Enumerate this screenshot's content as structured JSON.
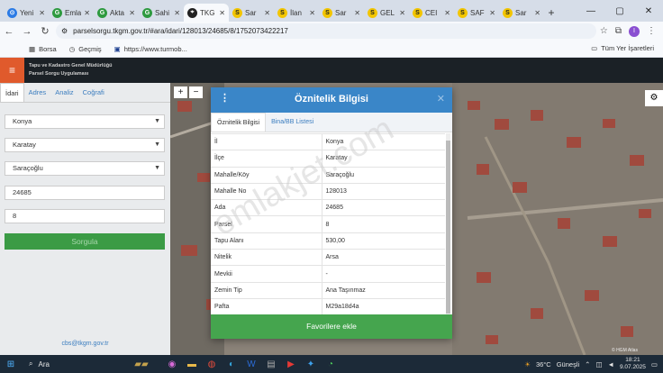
{
  "browser": {
    "tabs": [
      {
        "title": "Yeni",
        "icon": "chrome-icon",
        "color": "#2c7be5",
        "glyph": "⊙"
      },
      {
        "title": "Emla",
        "icon": "emlakjet-icon",
        "color": "#2e9a3f",
        "glyph": "G"
      },
      {
        "title": "Akta",
        "icon": "emlakjet-icon",
        "color": "#2e9a3f",
        "glyph": "G"
      },
      {
        "title": "Sahi",
        "icon": "emlakjet-icon",
        "color": "#2e9a3f",
        "glyph": "G"
      },
      {
        "title": "TKG",
        "icon": "location-pin-icon",
        "color": "#222222",
        "glyph": "⌖",
        "active": true
      },
      {
        "title": "Sar",
        "icon": "sahibinden-icon",
        "color": "#f2c500",
        "glyph": "S"
      },
      {
        "title": "İlan",
        "icon": "sahibinden-icon",
        "color": "#f2c500",
        "glyph": "S"
      },
      {
        "title": "Sar",
        "icon": "sahibinden-icon",
        "color": "#f2c500",
        "glyph": "S"
      },
      {
        "title": "GEL",
        "icon": "sahibinden-icon",
        "color": "#f2c500",
        "glyph": "S"
      },
      {
        "title": "CEI",
        "icon": "sahibinden-icon",
        "color": "#f2c500",
        "glyph": "S"
      },
      {
        "title": "SAF",
        "icon": "sahibinden-icon",
        "color": "#f2c500",
        "glyph": "S"
      },
      {
        "title": "Sar",
        "icon": "sahibinden-icon",
        "color": "#f2c500",
        "glyph": "S"
      }
    ],
    "url": "parselsorgu.tkgm.gov.tr/#ara/idari/128013/24685/8/1752073422217",
    "bookmarks": [
      {
        "label": "Borsa",
        "icon": "bookmark-icon"
      },
      {
        "label": "Geçmiş",
        "icon": "history-icon"
      },
      {
        "label": "https://www.turmob...",
        "icon": "turmob-icon"
      }
    ],
    "all_bookmarks": "Tüm Yer İşaretleri",
    "avatar_letter": "I"
  },
  "app": {
    "title_line1": "Tapu ve Kadastro Genel Müdürlüğü",
    "title_line2": "Parsel Sorgu Uygulaması"
  },
  "sidebar": {
    "tabs": [
      "İdari",
      "Adres",
      "Analiz",
      "Coğrafi"
    ],
    "province": "Konya",
    "district": "Karatay",
    "neighborhood": "Saraçoğlu",
    "ada": "24685",
    "parsel": "8",
    "search_button": "Sorgula",
    "email": "cbs@tkgm.gov.tr"
  },
  "modal": {
    "title": "Öznitelik Bilgisi",
    "tabs": [
      "Öznitelik Bilgisi",
      "Bina/BB Listesi"
    ],
    "rows": [
      {
        "label": "İl",
        "value": "Konya"
      },
      {
        "label": "İlçe",
        "value": "Karatay"
      },
      {
        "label": "Mahalle/Köy",
        "value": "Saraçoğlu"
      },
      {
        "label": "Mahalle No",
        "value": "128013"
      },
      {
        "label": "Ada",
        "value": "24685"
      },
      {
        "label": "Parsel",
        "value": "8"
      },
      {
        "label": "Tapu Alanı",
        "value": "530,00"
      },
      {
        "label": "Nitelik",
        "value": "Arsa"
      },
      {
        "label": "Mevkii",
        "value": "-"
      },
      {
        "label": "Zemin Tip",
        "value": "Ana Taşınmaz"
      },
      {
        "label": "Pafta",
        "value": "M29a18d4a"
      }
    ],
    "favorite_button": "Favorilere ekle"
  },
  "map": {
    "attribution": "© HGM Atlas",
    "watermark": "emlakjet.com"
  },
  "taskbar": {
    "search": "Ara",
    "weather": "36°C",
    "weather_desc": "Güneşli",
    "time": "18:21",
    "date": "9.07.2025"
  }
}
